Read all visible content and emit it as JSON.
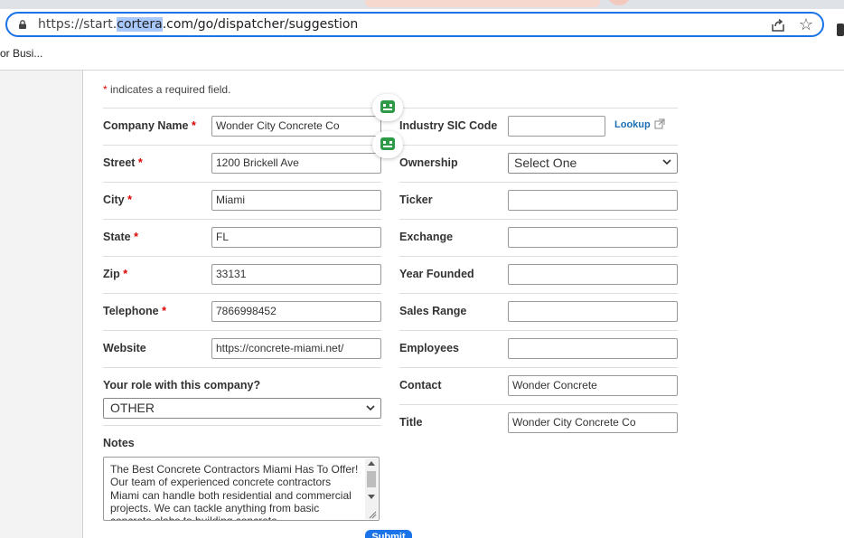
{
  "browser": {
    "url_prefix": "https://start.",
    "url_highlight": "cortera",
    "url_suffix": ".com/go/dispatcher/suggestion",
    "bookmark_item": "or Busi..."
  },
  "form": {
    "required_note": "indicates a required field.",
    "required_star": "*",
    "left_rows": [
      {
        "label": "Company Name",
        "required": true,
        "value": "Wonder City Concrete Co"
      },
      {
        "label": "Street",
        "required": true,
        "value": "1200 Brickell Ave"
      },
      {
        "label": "City",
        "required": true,
        "value": "Miami"
      },
      {
        "label": "State",
        "required": true,
        "value": "FL"
      },
      {
        "label": "Zip",
        "required": true,
        "value": "33131"
      },
      {
        "label": "Telephone",
        "required": true,
        "value": "7866998452"
      },
      {
        "label": "Website",
        "required": false,
        "value": "https://concrete-miami.net/"
      }
    ],
    "right_rows": [
      {
        "label": "Industry SIC Code",
        "value": "",
        "link": "Lookup"
      },
      {
        "label": "Ownership",
        "select": "Select One"
      },
      {
        "label": "Ticker",
        "value": ""
      },
      {
        "label": "Exchange",
        "value": ""
      },
      {
        "label": "Year Founded",
        "value": ""
      },
      {
        "label": "Sales Range",
        "value": ""
      },
      {
        "label": "Employees",
        "value": ""
      },
      {
        "label": "Contact",
        "value": "Wonder Concrete"
      },
      {
        "label": "Title",
        "value": "Wonder City Concrete Co"
      }
    ],
    "role_label": "Your role with this company?",
    "role_value": "OTHER",
    "notes_label": "Notes",
    "notes_value": "The Best Concrete Contractors Miami Has To Offer! Our team of experienced concrete contractors Miami can handle both residential and commercial projects. We can tackle anything from basic concrete slabs to building concrete",
    "submit_label": "Submit"
  },
  "colors": {
    "accent": "#1a73e8",
    "required": "#dd0000",
    "link": "#1a6fb5",
    "extension_icon": "#2e9a47"
  }
}
